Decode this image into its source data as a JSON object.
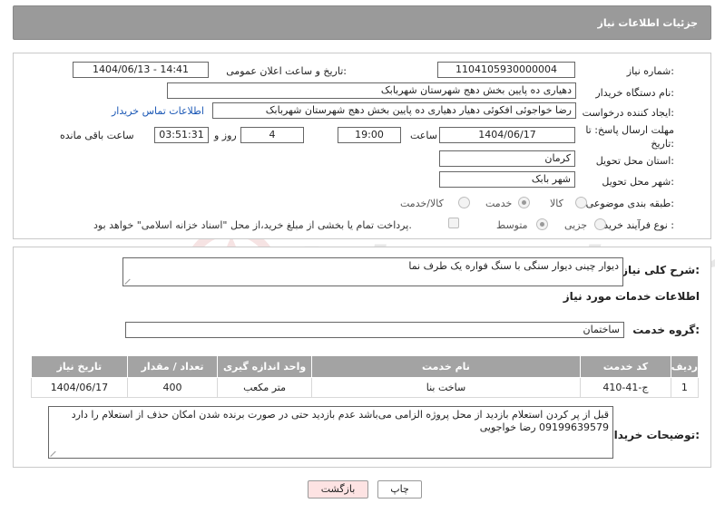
{
  "header": {
    "title": "جزئیات اطلاعات نیاز"
  },
  "fields": {
    "need_number": {
      "label": "شماره نیاز:",
      "value": "1104105930000004"
    },
    "announce_datetime": {
      "label": "تاریخ و ساعت اعلان عمومی:",
      "value": "1404/06/13 - 14:41"
    },
    "buyer_org": {
      "label": "نام دستگاه خریدار:",
      "value": "دهیاری ده پایین بخش دهج شهرستان شهربابک"
    },
    "requester": {
      "label": "ایجاد کننده درخواست:",
      "value": "رضا خواجوئی افکوئی دهیار دهیاری ده پایین بخش دهج شهرستان شهربابک"
    },
    "buyer_contact_link": "اطلاعات تماس خریدار",
    "deadline": {
      "label": "مهلت ارسال پاسخ: تا تاریخ:",
      "date": "1404/06/17",
      "time_label": "ساعت",
      "time": "19:00",
      "days": "4",
      "days_label": "روز و",
      "remaining": "03:51:31",
      "remaining_label": "ساعت باقی مانده"
    },
    "province": {
      "label": "استان محل تحویل:",
      "value": "کرمان"
    },
    "city": {
      "label": "شهر محل تحویل:",
      "value": "شهر بابک"
    },
    "category": {
      "label": "طبقه بندی موضوعی:",
      "options": [
        "کالا",
        "خدمت",
        "کالا/خدمت"
      ],
      "selected": "خدمت"
    },
    "purchase_type": {
      "label": "نوع فرآیند خرید :",
      "options": [
        "جزیی",
        "متوسط"
      ],
      "selected": "متوسط",
      "treasury_note": "پرداخت تمام یا بخشی از مبلغ خرید،از محل \"اسناد خزانه اسلامی\" خواهد بود."
    }
  },
  "general_description": {
    "label": "شرح کلی نیاز:",
    "value": "دیوار چینی دیوار سنگی با سنگ فواره یک طرف نما"
  },
  "services_info": {
    "title": "اطلاعات خدمات مورد نیاز",
    "group_label": "گروه خدمت:",
    "group_value": "ساختمان"
  },
  "services_table": {
    "columns": [
      "ردیف",
      "کد خدمت",
      "نام خدمت",
      "واحد اندازه گیری",
      "تعداد / مقدار",
      "تاریخ نیاز"
    ],
    "rows": [
      [
        "1",
        "ج-41-410",
        "ساخت بنا",
        "متر مکعب",
        "400",
        "1404/06/17"
      ]
    ]
  },
  "buyer_notes": {
    "label": "توضیحات خریدار:",
    "line1": "قبل از پر کردن استعلام بازدید از محل پروژه الزامی می‌باشد عدم بازدید حتی در صورت برنده شدن امکان حذف از استعلام را دارد",
    "line2": "09199639579 رضا خواجویی"
  },
  "buttons": {
    "print": "چاپ",
    "back": "بازگشت"
  },
  "watermark": {
    "text": "AriaTender.neT"
  },
  "colors": {
    "header_bg": "#9a9a9a",
    "link": "#1a57b5",
    "back_button_bg": "#fde3e3",
    "table_header_bg": "#a3a3a3"
  }
}
